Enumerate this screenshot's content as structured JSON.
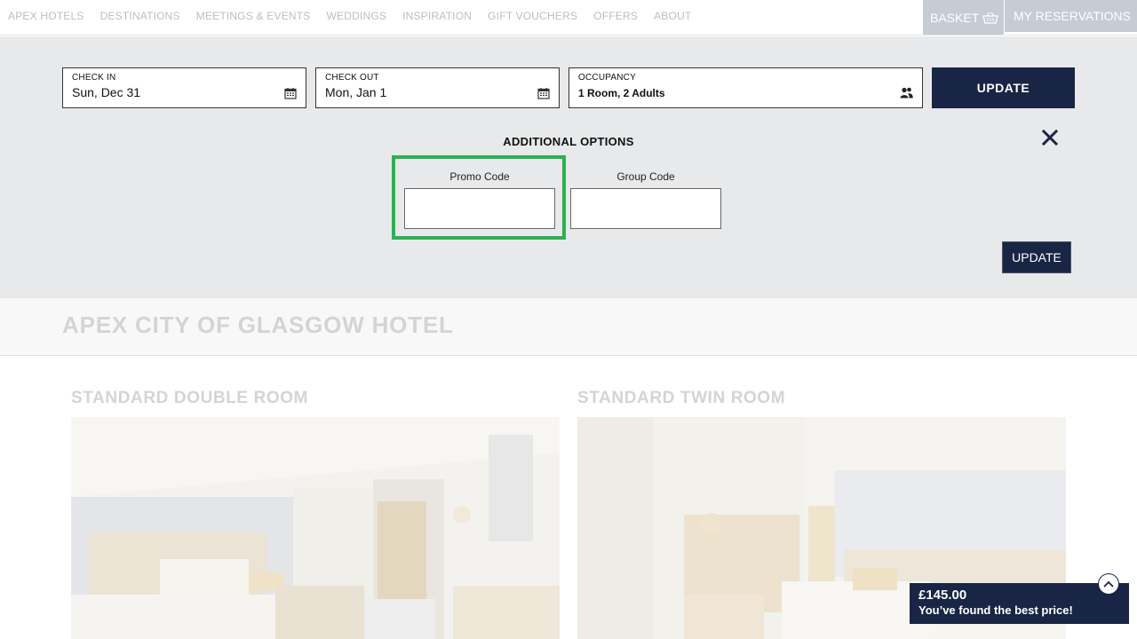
{
  "nav": {
    "links": [
      "APEX HOTELS",
      "DESTINATIONS",
      "MEETINGS & EVENTS",
      "WEDDINGS",
      "INSPIRATION",
      "GIFT VOUCHERS",
      "OFFERS",
      "ABOUT"
    ],
    "basket_label": "BASKET",
    "reservations_label": "MY RESERVATIONS"
  },
  "search": {
    "checkin_label": "CHECK IN",
    "checkin_value": "Sun, Dec 31",
    "checkout_label": "CHECK OUT",
    "checkout_value": "Mon, Jan 1",
    "occupancy_label": "OCCUPANCY",
    "occupancy_value": "1 Room, 2 Adults",
    "update_label": "UPDATE"
  },
  "options": {
    "title": "ADDITIONAL OPTIONS",
    "promo_label": "Promo Code",
    "promo_value": "",
    "group_label": "Group Code",
    "group_value": "",
    "update_label": "UPDATE"
  },
  "hotel": {
    "name": "APEX CITY OF GLASGOW HOTEL"
  },
  "rooms": [
    {
      "title": "STANDARD DOUBLE ROOM"
    },
    {
      "title": "STANDARD TWIN ROOM"
    }
  ],
  "price": {
    "amount": "£145.00",
    "message": "You’ve found the best price!"
  },
  "colors": {
    "navy": "#182544",
    "panel": "#e8e9ea",
    "highlight": "#2cb24f"
  }
}
